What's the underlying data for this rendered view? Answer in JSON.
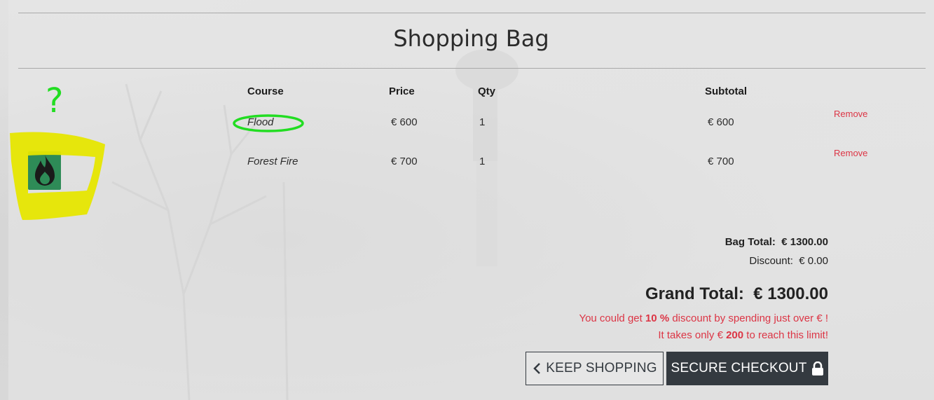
{
  "page": {
    "title": "Shopping Bag"
  },
  "table": {
    "headers": {
      "course": "Course",
      "price": "Price",
      "qty": "Qty",
      "subtotal": "Subtotal"
    },
    "rows": [
      {
        "name": "Flood",
        "price": "€ 600",
        "qty": "1",
        "subtotal": "€ 600",
        "remove": "Remove"
      },
      {
        "name": "Forest Fire",
        "price": "€ 700",
        "qty": "1",
        "subtotal": "€ 700",
        "remove": "Remove"
      }
    ]
  },
  "summary": {
    "bag_total_label": "Bag Total:",
    "bag_total_value": "€ 1300.00",
    "discount_label": "Discount:",
    "discount_value": "€ 0.00",
    "grand_total_label": "Grand Total:",
    "grand_total_value": "€ 1300.00",
    "discount_msg_prefix": "You could get",
    "discount_percent": "10 %",
    "discount_msg_mid": "discount by spending just over",
    "discount_msg_currency": "€",
    "discount_msg_end": "!",
    "limit_prefix": "It takes only",
    "limit_currency": "€",
    "limit_amount": "200",
    "limit_suffix": "to reach this limit!"
  },
  "buttons": {
    "keep_shopping": "Keep Shopping",
    "secure_checkout": "Secure Checkout"
  },
  "annotations": {
    "question_mark": "?"
  },
  "colors": {
    "danger": "#dc3545",
    "dark": "#343a40",
    "highlight_yellow": "#e6e600",
    "highlight_green": "#22dd22",
    "thumb_green": "#2e8b57"
  },
  "icons": {
    "keep_shopping": "chevron-left-icon",
    "checkout": "lock-icon",
    "thumbnail": "flame-icon"
  }
}
